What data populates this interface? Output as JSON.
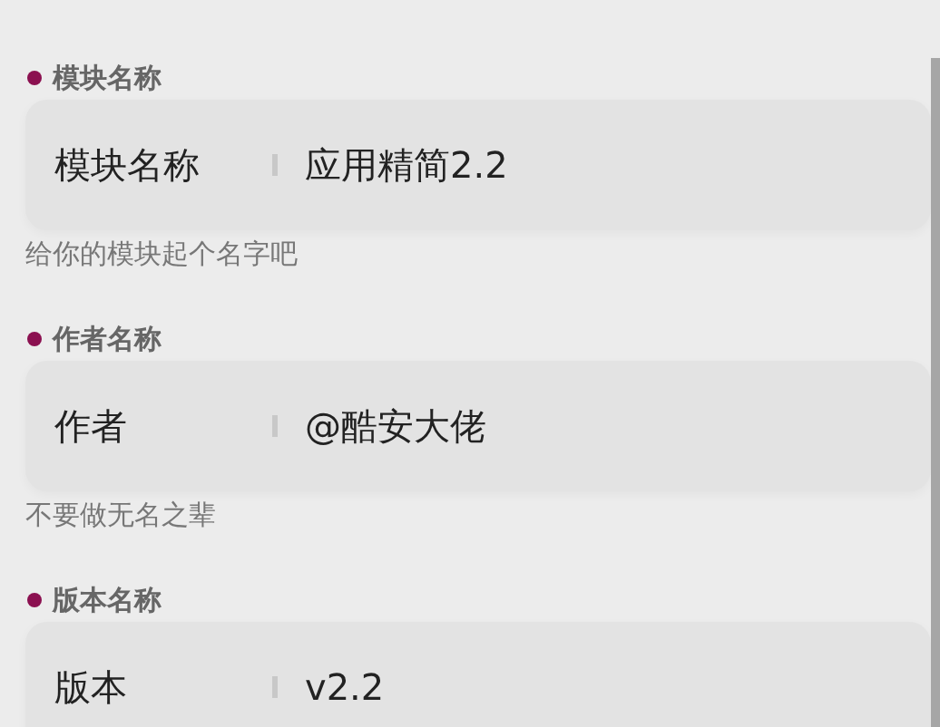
{
  "sections": [
    {
      "header": "模块名称",
      "label": "模块名称",
      "value": "应用精简2.2",
      "hint": "给你的模块起个名字吧"
    },
    {
      "header": "作者名称",
      "label": "作者",
      "value": "@酷安大佬",
      "hint": "不要做无名之辈"
    },
    {
      "header": "版本名称",
      "label": "版本",
      "value": "v2.2"
    }
  ]
}
